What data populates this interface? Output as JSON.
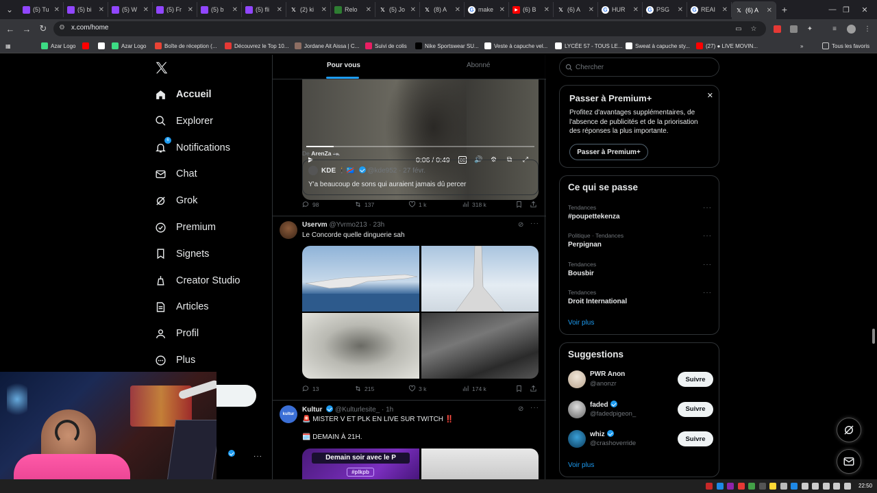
{
  "browser": {
    "tabs": [
      {
        "title": "(5) Tu",
        "icon": "twitch-icon",
        "color": "#9146ff"
      },
      {
        "title": "(5) bi",
        "icon": "twitch-icon",
        "color": "#9146ff"
      },
      {
        "title": "(5) W",
        "icon": "twitch-icon",
        "color": "#9146ff"
      },
      {
        "title": "(5) Fr",
        "icon": "twitch-icon",
        "color": "#9146ff"
      },
      {
        "title": "(5) b",
        "icon": "twitch-icon",
        "color": "#9146ff"
      },
      {
        "title": "(5) fli",
        "icon": "twitch-icon",
        "color": "#9146ff"
      },
      {
        "title": "(2) ki",
        "icon": "x-icon",
        "color": "#000000"
      },
      {
        "title": "Relo",
        "icon": "page-icon",
        "color": "#2e7d32"
      },
      {
        "title": "(5) Jo",
        "icon": "x-icon",
        "color": "#000000"
      },
      {
        "title": "(8) A",
        "icon": "x-icon",
        "color": "#000000"
      },
      {
        "title": "make",
        "icon": "google-icon",
        "color": "#ffffff"
      },
      {
        "title": "(6) B",
        "icon": "youtube-icon",
        "color": "#ff0000"
      },
      {
        "title": "(6) A",
        "icon": "x-icon",
        "color": "#000000"
      },
      {
        "title": "HUR",
        "icon": "google-icon",
        "color": "#ffffff"
      },
      {
        "title": "PSG",
        "icon": "google-icon",
        "color": "#ffffff"
      },
      {
        "title": "REAI",
        "icon": "google-icon",
        "color": "#ffffff"
      },
      {
        "title": "(6) A",
        "icon": "x-icon",
        "color": "#000000",
        "active": true
      }
    ],
    "url": "x.com/home",
    "bookmarks": [
      {
        "label": "Azar Logo",
        "color": "#3ddc84"
      },
      {
        "label": "",
        "color": "#ff0000"
      },
      {
        "label": "",
        "color": "#ffffff"
      },
      {
        "label": "Azar Logo",
        "color": "#3ddc84"
      },
      {
        "label": "Boîte de réception (...",
        "color": "#ea4335"
      },
      {
        "label": "Découvrez le Top 10...",
        "color": "#e53935"
      },
      {
        "label": "Jordane Ait Aissa | C...",
        "color": "#8d6e63"
      },
      {
        "label": "Suivi de colis",
        "color": "#e91e63"
      },
      {
        "label": "Nike Sportswear SU...",
        "color": "#000000"
      },
      {
        "label": "Veste à capuche vel...",
        "color": "#ffffff"
      },
      {
        "label": "LYCÉE 57 - TOUS LE...",
        "color": "#ffffff"
      },
      {
        "label": "Sweat à capuche sty...",
        "color": "#ffffff"
      },
      {
        "label": "(27) ● LIVE MOVIN...",
        "color": "#ff0000"
      }
    ],
    "all_bookmarks": "Tous les favoris"
  },
  "nav": {
    "items": [
      {
        "label": "Accueil",
        "icon": "home-icon"
      },
      {
        "label": "Explorer",
        "icon": "search-icon"
      },
      {
        "label": "Notifications",
        "icon": "bell-icon",
        "badge": "6"
      },
      {
        "label": "Chat",
        "icon": "mail-icon"
      },
      {
        "label": "Grok",
        "icon": "grok-icon"
      },
      {
        "label": "Premium",
        "icon": "premium-icon"
      },
      {
        "label": "Signets",
        "icon": "bookmark-icon"
      },
      {
        "label": "Creator Studio",
        "icon": "creator-icon"
      },
      {
        "label": "Articles",
        "icon": "articles-icon"
      },
      {
        "label": "Profil",
        "icon": "person-icon"
      },
      {
        "label": "Plus",
        "icon": "more-icon"
      }
    ]
  },
  "feed": {
    "tabs": [
      "Pour vous",
      "Abonné"
    ],
    "video": {
      "time": "0:06 / 0:49"
    },
    "post1": {
      "from_prefix": "De",
      "from_name": "ArenZa",
      "quote_name": "KDE",
      "quote_handle": "@kde952 · 27 févr.",
      "quote_text": "Y'a beaucoup de sons qui auraient jamais dû percer",
      "replies": "98",
      "reposts": "137",
      "likes": "1 k",
      "views": "318 k"
    },
    "post2": {
      "name": "Uservm",
      "handle": "@Yvrmo213 · 23h",
      "text": "Le Concorde quelle dinguerie sah",
      "replies": "13",
      "reposts": "215",
      "likes": "3 k",
      "views": "174 k"
    },
    "post3": {
      "name": "Kultur",
      "handle": "@Kulturlesite_ · 1h",
      "line1": "🚨 MISTER V ET PLK EN LIVE SUR TWITCH ‼️",
      "line2": "🗓️ DEMAIN À 21H.",
      "image_text": "Demain soir avec le P",
      "image_tag": "#plkpb"
    }
  },
  "right": {
    "search_placeholder": "Chercher",
    "premium": {
      "title": "Passer à Premium+",
      "desc": "Profitez d'avantages supplémentaires, de l'absence de publicités et de la priorisation des réponses la plus importante.",
      "button": "Passer à Premium+"
    },
    "trends": {
      "title": "Ce qui se passe",
      "items": [
        {
          "cat": "Tendances",
          "name": "#poupettekenza"
        },
        {
          "cat": "Politique · Tendances",
          "name": "Perpignan"
        },
        {
          "cat": "Tendances",
          "name": "Bousbir"
        },
        {
          "cat": "Tendances",
          "name": "Droit International"
        }
      ],
      "more": "Voir plus"
    },
    "suggestions": {
      "title": "Suggestions",
      "items": [
        {
          "name": "PWR Anon",
          "handle": "@anonzr",
          "verified": false,
          "button": "Suivre"
        },
        {
          "name": "faded",
          "handle": "@fadedpigeon_",
          "verified": true,
          "button": "Suivre"
        },
        {
          "name": "whiz",
          "handle": "@crashoverride",
          "verified": true,
          "button": "Suivre"
        }
      ],
      "more": "Voir plus"
    }
  },
  "taskbar": {
    "clock": "22:50"
  }
}
